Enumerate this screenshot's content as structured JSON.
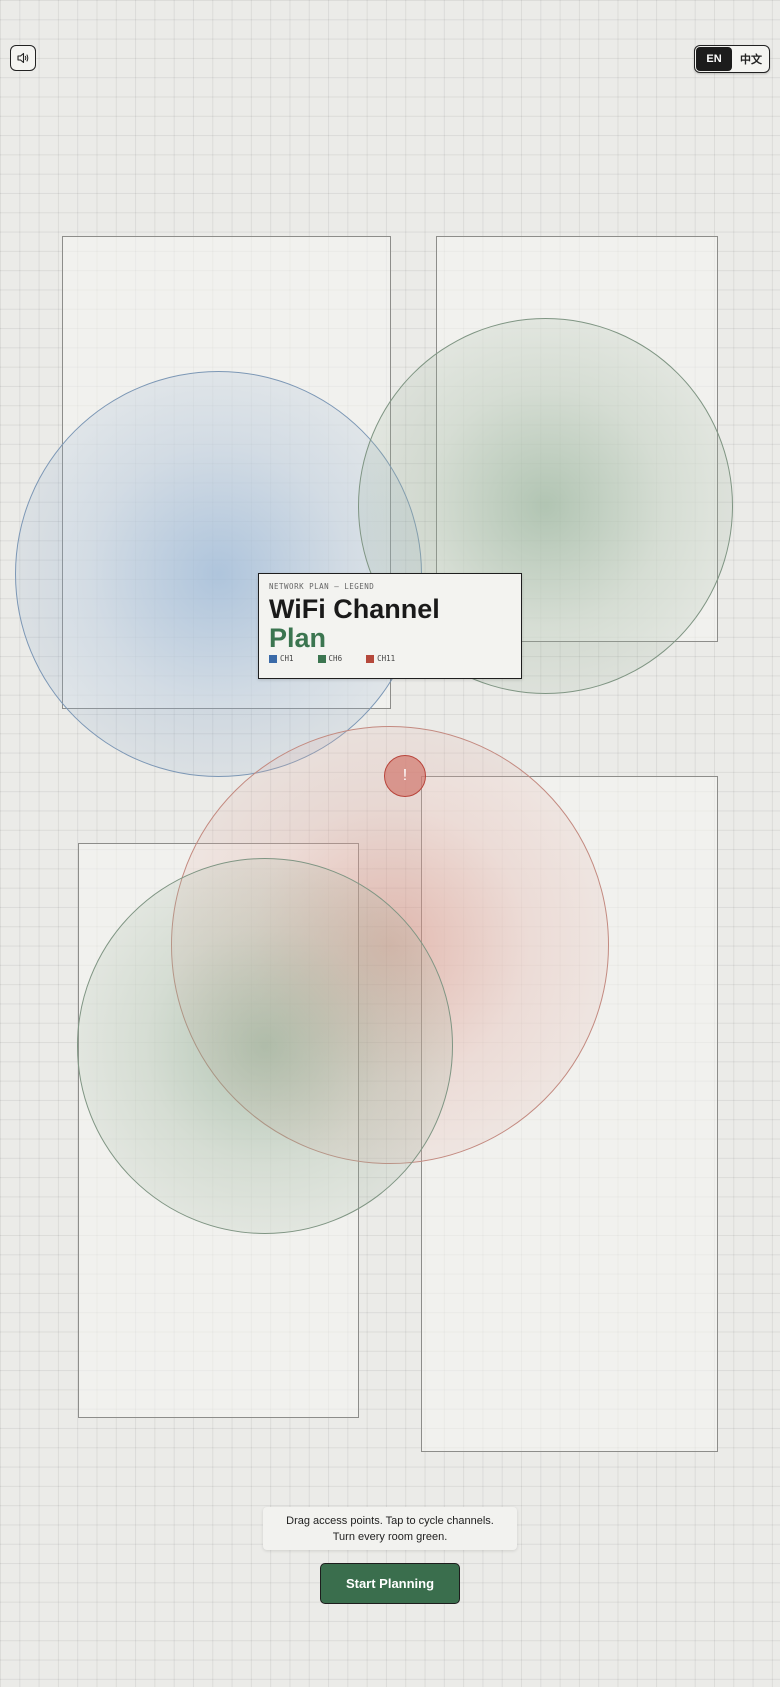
{
  "header": {
    "sound_icon": "speaker-icon",
    "languages": [
      {
        "label": "EN",
        "active": true
      },
      {
        "label": "中文",
        "active": false
      }
    ]
  },
  "alert": {
    "symbol": "!"
  },
  "legend": {
    "kicker": "NETWORK PLAN — LEGEND",
    "title_line1": "WiFi Channel",
    "title_line2": "Plan",
    "keys": [
      {
        "label": "CH1",
        "color": "#3a6aa8"
      },
      {
        "label": "CH6",
        "color": "#3b7550"
      },
      {
        "label": "CH11",
        "color": "#b5483b"
      }
    ]
  },
  "instructions": "Drag access points. Tap to cycle channels. Turn every room green.",
  "start_button": "Start Planning",
  "colors": {
    "ch1": "#7c97b5",
    "ch6": "#7f9583",
    "ch11": "#c38a80",
    "accent": "#3a6e4d"
  }
}
